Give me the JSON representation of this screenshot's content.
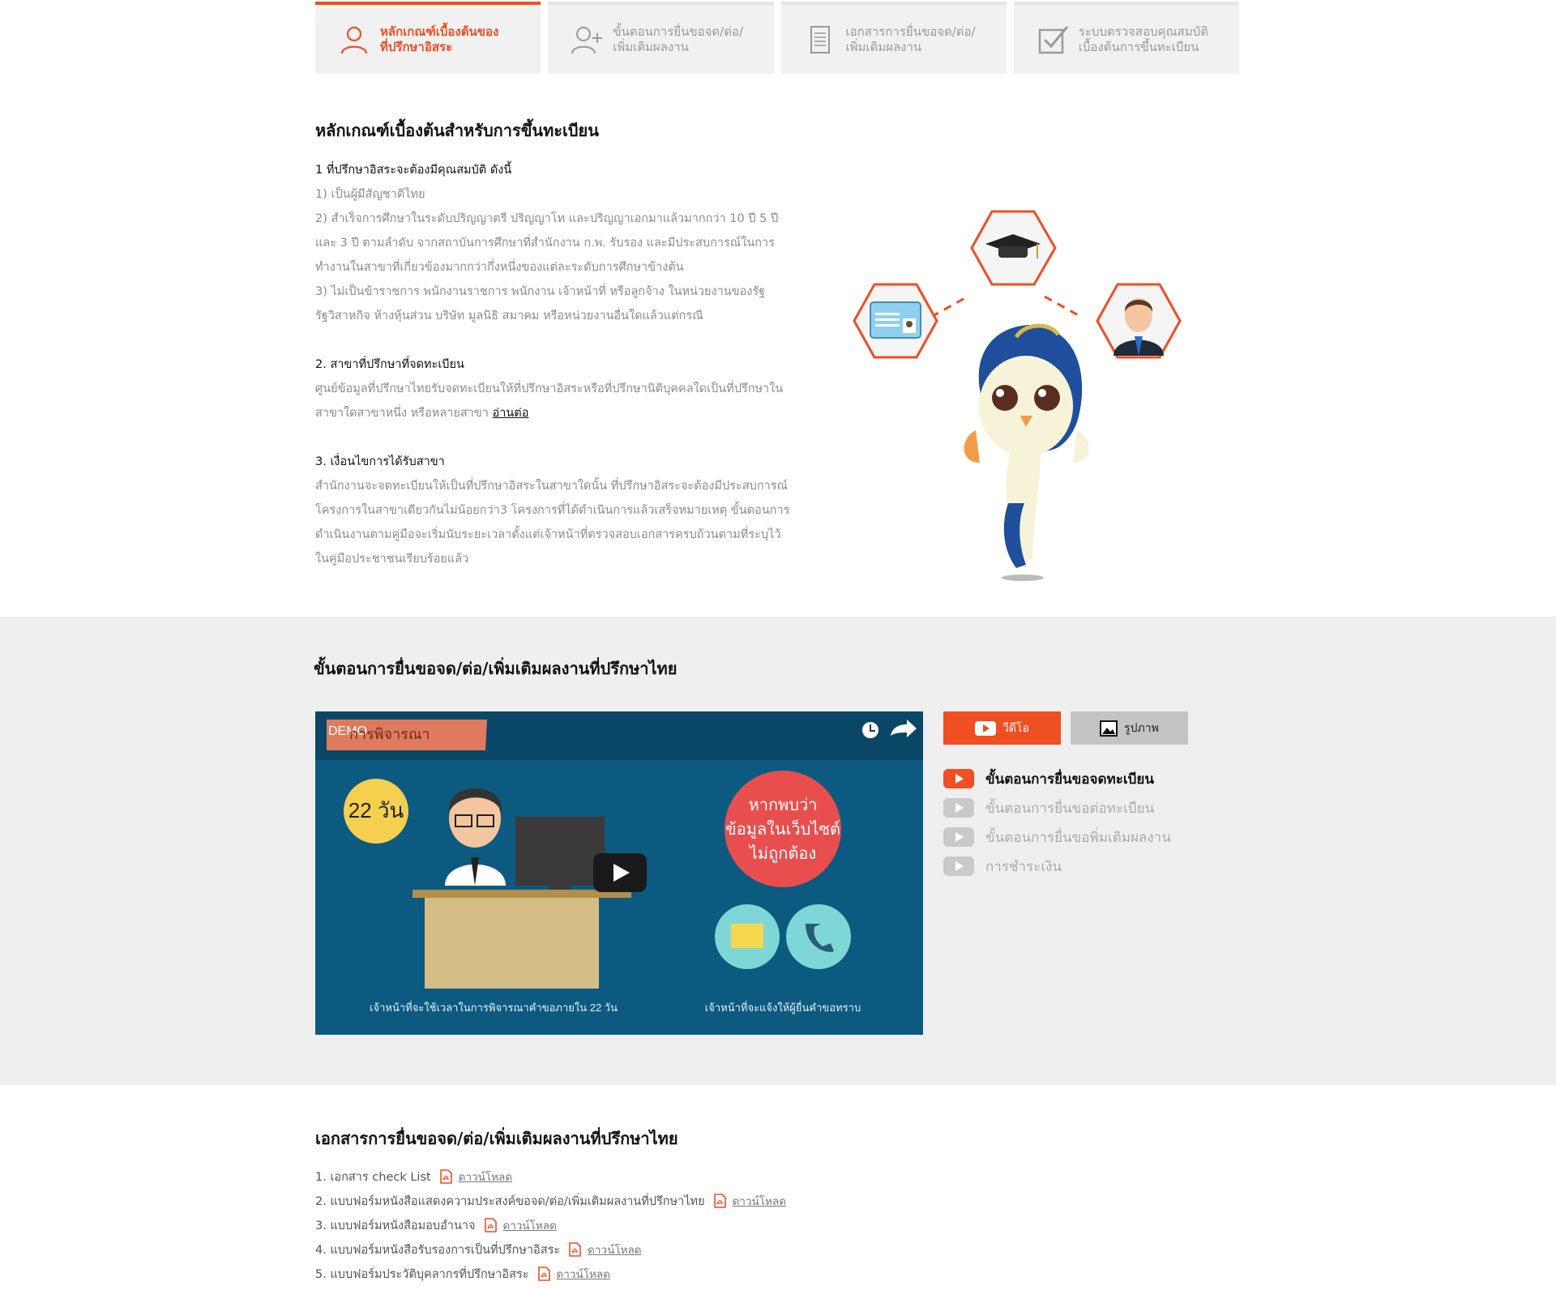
{
  "tabs": [
    {
      "label": "หลักเกณฑ์เบื้องต้นของ\nที่ปรึกษาอิสระ",
      "icon": "user-icon",
      "active": true
    },
    {
      "label": "ขั้นตอนการยื่นขอจด/ต่อ/\nเพิ่มเติมผลงาน",
      "icon": "add-user-icon",
      "active": false
    },
    {
      "label": "เอกสารการยื่นขอจด/ต่อ/\nเพิ่มเติมผลงาน",
      "icon": "document-icon",
      "active": false
    },
    {
      "label": "ระบบตรวจสอบคุณสมบัติ\nเบื้องต้นการขึ้นทะเบียน",
      "icon": "checkbox-icon",
      "active": false
    }
  ],
  "criteria": {
    "title": "หลักเกณฑ์เบื้องต้นสำหรับการขึ้นทะเบียน",
    "s1_head": "1 ที่ปรึกษาอิสระจะต้องมีคุณสมบัติ ดังนี้",
    "s1_l1": "1) เป็นผู้มีสัญชาติไทย",
    "s1_l2": "2) สำเร็จการศึกษาในระดับปริญญาตรี ปริญญาโท และปริญญาเอกมาแล้วมากกว่า 10 ปี 5 ปี และ 3 ปี ตามลำดับ จากสถาบันการศึกษาที่สำนักงาน ก.พ. รับรอง และมีประสบการณ์ในการทำงานในสาขาที่เกี่ยวข้องมากกว่ากึ่งหนึ่งของแต่ละระดับการศึกษาข้างต้น",
    "s1_l3": "3) ไม่เป็นข้าราชการ พนักงานราชการ พนักงาน เจ้าหน้าที่ หรือลูกจ้าง ในหน่วยงานของรัฐ รัฐวิสาหกิจ ห้างหุ้นส่วน บริษัท มูลนิธิ สมาคม หรือหน่วยงานอื่นใดแล้วแต่กรณี",
    "s2_head": "2. สาขาที่ปรึกษาที่จดทะเบียน",
    "s2_text": "ศูนย์ข้อมูลที่ปรึกษาไทยรับจดทะเบียนให้ที่ปรึกษาอิสระหรือที่ปรึกษานิติบุคคลใดเป็นที่ปรึกษาในสาขาใดสาขาหนึ่ง หรือหลายสาขา",
    "s2_link": "อ่านต่อ",
    "s3_head": "3. เงื่อนไขการได้รับสาขา",
    "s3_text": "สำนักงานจะจดทะเบียนให้เป็นที่ปรึกษาอิสระในสาขาใดนั้น ที่ปรึกษาอิสระจะต้องมีประสบการณ์โครงการในสาขาเดียวกันไม่น้อยกว่า3 โครงการที่ได้ดำเนินการแล้วเสร็จหมายเหตุ ขั้นตอนการดำเนินงานตามคู่มือจะเริ่มนับระยะเวลาตั้งแต่เจ้าหน้าที่ตรวจสอบเอกสารครบถ้วนตามที่ระบุไว้ในคู่มือประชาชนเรียบร้อยแล้ว"
  },
  "process": {
    "title": "ขั้นตอนการยื่นขอจด/ต่อ/เพิ่มเติมผลงานที่ปรึกษาไทย",
    "video": {
      "demo": "DEMO",
      "banner": "การพิจารณา",
      "days": "22 วัน",
      "bubble": "หากพบว่า\nข้อมูลในเว็บไซต์\nไม่ถูกต้อง",
      "caption_left": "เจ้าหน้าที่จะใช้เวลาในการพิจารณาคำขอภายใน 22 วัน",
      "caption_right": "เจ้าหน้าที่จะแจ้งให้ผู้ยื่นคำขอทราบ"
    },
    "btn_video": "วีดีโอ",
    "btn_image": "รูปภาพ",
    "videos": [
      {
        "label": "ขั้นตอนการยื่นขอจดทะเบียน",
        "active": true
      },
      {
        "label": "ขั้นตอนการยื่นขอต่อทะเบียน",
        "active": false
      },
      {
        "label": "ขั้นตอนการยื่นขอพิ่มเติมผลงาน",
        "active": false
      },
      {
        "label": "การชำระเงิน",
        "active": false
      }
    ]
  },
  "documents": {
    "title": "เอกสารการยื่นขอจด/ต่อ/เพิ่มเติมผลงานที่ปรึกษาไทย",
    "download_label": "ดาวน์โหลด",
    "items": [
      "1. เอกสาร check List",
      "2. แบบฟอร์มหนังสือแสดงความประสงค์ขอจด/ต่อ/เพิ่มเติมผลงานที่ปรึกษาไทย",
      "3. แบบฟอร์มหนังสือมอบอำนาจ",
      "4. แบบฟอร์มหนังสือรับรองการเป็นที่ปรึกษาอิสระ",
      "5. แบบฟอร์มประวัติบุคลากรที่ปรึกษาอิสระ"
    ]
  },
  "colors": {
    "accent": "#f04e23",
    "video_bg": "#0d5a80"
  }
}
